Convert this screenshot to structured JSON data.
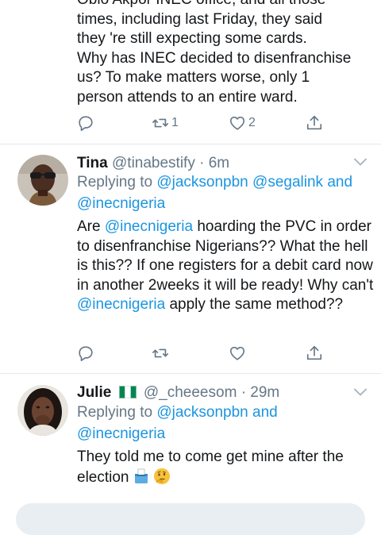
{
  "tweet0": {
    "lines": [
      "Obio Akpor INEC office, and all those",
      "times, including last Friday, they said",
      "they 're still expecting some cards.",
      "Why has INEC decided to disenfranchise",
      "us? To make matters worse, only 1",
      "person attends to an entire ward."
    ],
    "retweet_count": "1",
    "like_count": "2"
  },
  "tweet1": {
    "name": "Tina",
    "handle": "@tinabestify",
    "time": "6m",
    "separator": "·",
    "replying_label": "Replying to",
    "reply_mention_1": "@jacksonpbn",
    "reply_mention_2": "@segalink",
    "reply_and": "and",
    "reply_mention_3": "@inecnigeria",
    "text_1": "Are ",
    "text_mention_1": "@inecnigeria",
    "text_2": " hoarding the PVC in order to disenfranchise Nigerians?? What the hell is this?? If one registers for a debit card now in another 2weeks it will be ready! Why can't ",
    "text_mention_2": "@inecnigeria",
    "text_3": " apply the same method??"
  },
  "tweet2": {
    "name": "Julie",
    "handle": "@_cheeesom",
    "time": "29m",
    "separator": "·",
    "replying_label": "Replying to",
    "reply_mention_1": "@jacksonpbn",
    "reply_and": "and",
    "reply_mention_2": "@inecnigeria",
    "text": "They told me to come get mine after the election"
  },
  "icons": {
    "reply": "reply-icon",
    "retweet": "retweet-icon",
    "like": "heart-icon",
    "share": "share-icon",
    "more": "chevron-down-icon",
    "flag": "nigeria-flag-icon",
    "ballot": "ballot-box-icon",
    "thinking": "thinking-face-icon"
  },
  "colors": {
    "link": "#1b95e0",
    "muted": "#657786",
    "divider": "#e1e8ed"
  }
}
